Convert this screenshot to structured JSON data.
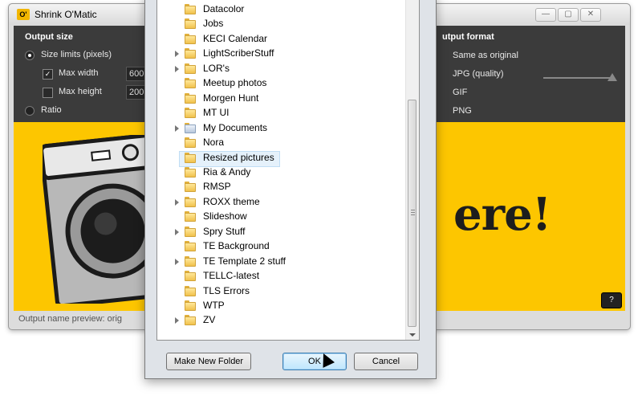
{
  "app": {
    "title": "Shrink O'Matic",
    "icon_label": "O'",
    "window_buttons": {
      "minimize": "—",
      "maximize": "▢",
      "close": "✕"
    }
  },
  "output_size": {
    "title": "Output size",
    "size_limits_label": "Size limits (pixels)",
    "max_width_label": "Max width",
    "max_width_value": "600",
    "max_height_label": "Max height",
    "max_height_value": "200",
    "ratio_label": "Ratio"
  },
  "output_format": {
    "title": "utput format",
    "options": [
      "Same as original",
      "JPG (quality)",
      "GIF",
      "PNG"
    ]
  },
  "drop_area": {
    "text": "ere!",
    "help_label": "?"
  },
  "preview": {
    "label": "Output name preview: orig"
  },
  "folder_dialog": {
    "items": [
      {
        "label": "Datacolor",
        "expandable": false
      },
      {
        "label": "Jobs",
        "expandable": false
      },
      {
        "label": "KECI Calendar",
        "expandable": false
      },
      {
        "label": "LightScriberStuff",
        "expandable": true
      },
      {
        "label": "LOR's",
        "expandable": true
      },
      {
        "label": "Meetup photos",
        "expandable": false
      },
      {
        "label": "Morgen Hunt",
        "expandable": false
      },
      {
        "label": "MT UI",
        "expandable": false
      },
      {
        "label": "My Documents",
        "expandable": true,
        "icon": "documents"
      },
      {
        "label": "Nora",
        "expandable": false
      },
      {
        "label": "Resized pictures",
        "expandable": false,
        "selected": true
      },
      {
        "label": "Ria & Andy",
        "expandable": false
      },
      {
        "label": "RMSP",
        "expandable": false
      },
      {
        "label": "ROXX theme",
        "expandable": true
      },
      {
        "label": "Slideshow",
        "expandable": false
      },
      {
        "label": "Spry Stuff",
        "expandable": true
      },
      {
        "label": "TE Background",
        "expandable": false
      },
      {
        "label": "TE Template 2 stuff",
        "expandable": true
      },
      {
        "label": "TELLC-latest",
        "expandable": false
      },
      {
        "label": "TLS Errors",
        "expandable": false
      },
      {
        "label": "WTP",
        "expandable": false
      },
      {
        "label": "ZV",
        "expandable": true
      }
    ],
    "make_new_folder_label": "Make New Folder",
    "ok_label": "OK",
    "cancel_label": "Cancel"
  },
  "colors": {
    "drop_background": "#fdc600",
    "panel_dark": "#3b3b3b",
    "selection": "#e5f1fb"
  }
}
